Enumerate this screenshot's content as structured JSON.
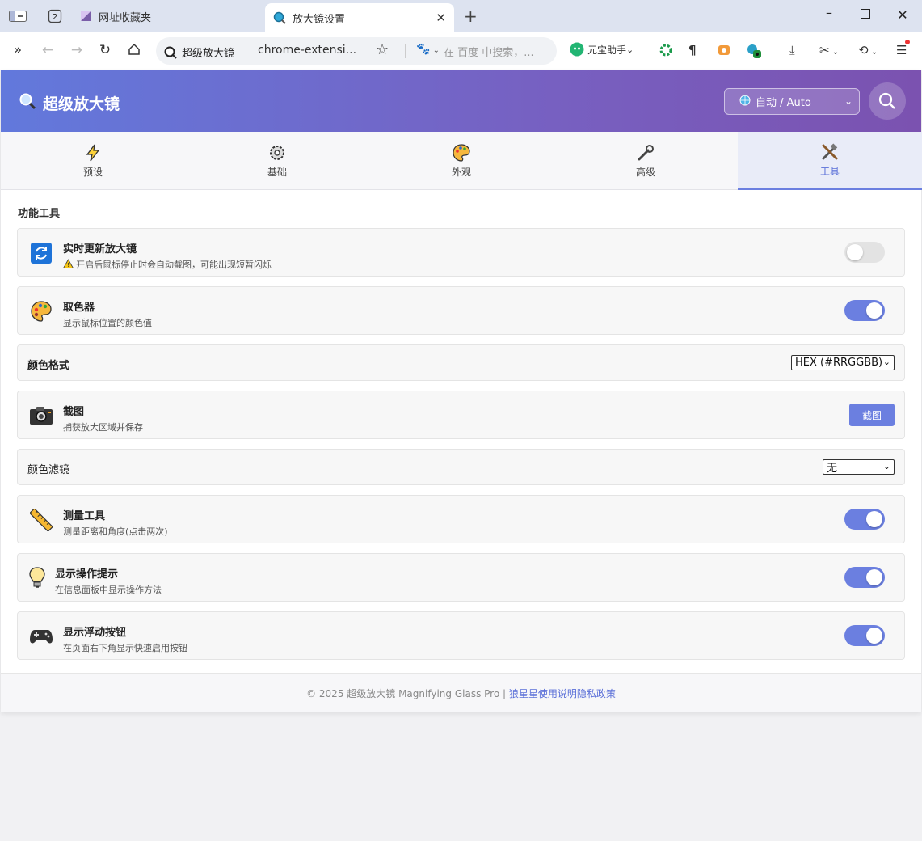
{
  "browser": {
    "tabs": [
      {
        "title": "网址收藏夹"
      },
      {
        "title": "放大镜设置"
      }
    ],
    "tab_count": "2",
    "address": {
      "site_name": "超级放大镜",
      "url": "chrome-extensi...",
      "search_placeholder": "在 百度 中搜索，..."
    },
    "assistant_label": "元宝助手"
  },
  "header": {
    "title": "超级放大镜",
    "language_select": "自动 / Auto"
  },
  "tabs": [
    {
      "label": "预设",
      "icon": "lightning-icon"
    },
    {
      "label": "基础",
      "icon": "gear-icon"
    },
    {
      "label": "外观",
      "icon": "palette-icon"
    },
    {
      "label": "高级",
      "icon": "wrench-icon"
    },
    {
      "label": "工具",
      "icon": "tools-icon",
      "active": true
    }
  ],
  "section_title": "功能工具",
  "settings": {
    "realtime": {
      "label": "实时更新放大镜",
      "desc": "开启后鼠标停止时会自动截图，可能出现短暂闪烁",
      "enabled": false
    },
    "color_picker": {
      "label": "取色器",
      "desc": "显示鼠标位置的颜色值",
      "enabled": true
    },
    "color_format": {
      "label": "颜色格式",
      "value": "HEX (#RRGGBB)"
    },
    "screenshot": {
      "label": "截图",
      "desc": "捕获放大区域并保存",
      "button": "截图"
    },
    "color_filter": {
      "label": "颜色滤镜",
      "value": "无"
    },
    "measure": {
      "label": "测量工具",
      "desc": "测量距离和角度(点击两次)",
      "enabled": true
    },
    "hints": {
      "label": "显示操作提示",
      "desc": "在信息面板中显示操作方法",
      "enabled": true
    },
    "floating": {
      "label": "显示浮动按钮",
      "desc": "在页面右下角显示快速启用按钮",
      "enabled": true
    }
  },
  "footer": {
    "copyright": "© 2025 超级放大镜 Magnifying Glass Pro |",
    "links": [
      "狼星星",
      "使用说明",
      "隐私政策"
    ]
  },
  "colors": {
    "accent": "#6b7fe0",
    "header_start": "#6279dc",
    "header_end": "#7b52b0"
  }
}
